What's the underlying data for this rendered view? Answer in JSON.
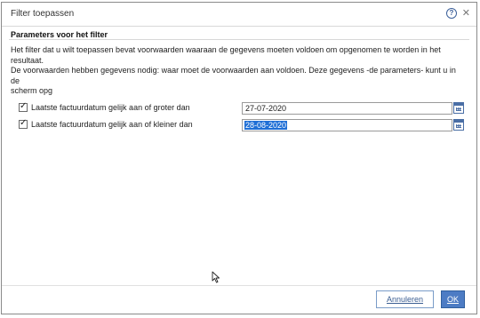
{
  "window": {
    "title": "Filter toepassen"
  },
  "section": {
    "header": "Parameters voor het filter",
    "description_line1": "Het filter dat u wilt toepassen bevat voorwaarden waaraan de gegevens moeten voldoen om opgenomen te worden in het resultaat.",
    "description_line2": "De voorwaarden hebben gegevens nodig: waar moet de voorwaarden aan voldoen. Deze gegevens -de parameters- kunt u in de",
    "description_line3": "scherm opg"
  },
  "parameters": [
    {
      "label": "Laatste factuurdatum gelijk aan of groter dan",
      "checked": true,
      "value": "27-07-2020",
      "selected": false
    },
    {
      "label": "Laatste factuurdatum gelijk aan of kleiner dan",
      "checked": true,
      "value": "28-08-2020",
      "selected": true
    }
  ],
  "buttons": {
    "cancel": "Annuleren",
    "ok": "OK"
  },
  "icons": {
    "help": "help-icon",
    "close": "close-icon",
    "calendar": "calendar-icon",
    "check": "checkmark-icon"
  },
  "colors": {
    "accent": "#4d7cc4",
    "selection": "#1f6fd6",
    "calendar": "#4a6ea5"
  }
}
